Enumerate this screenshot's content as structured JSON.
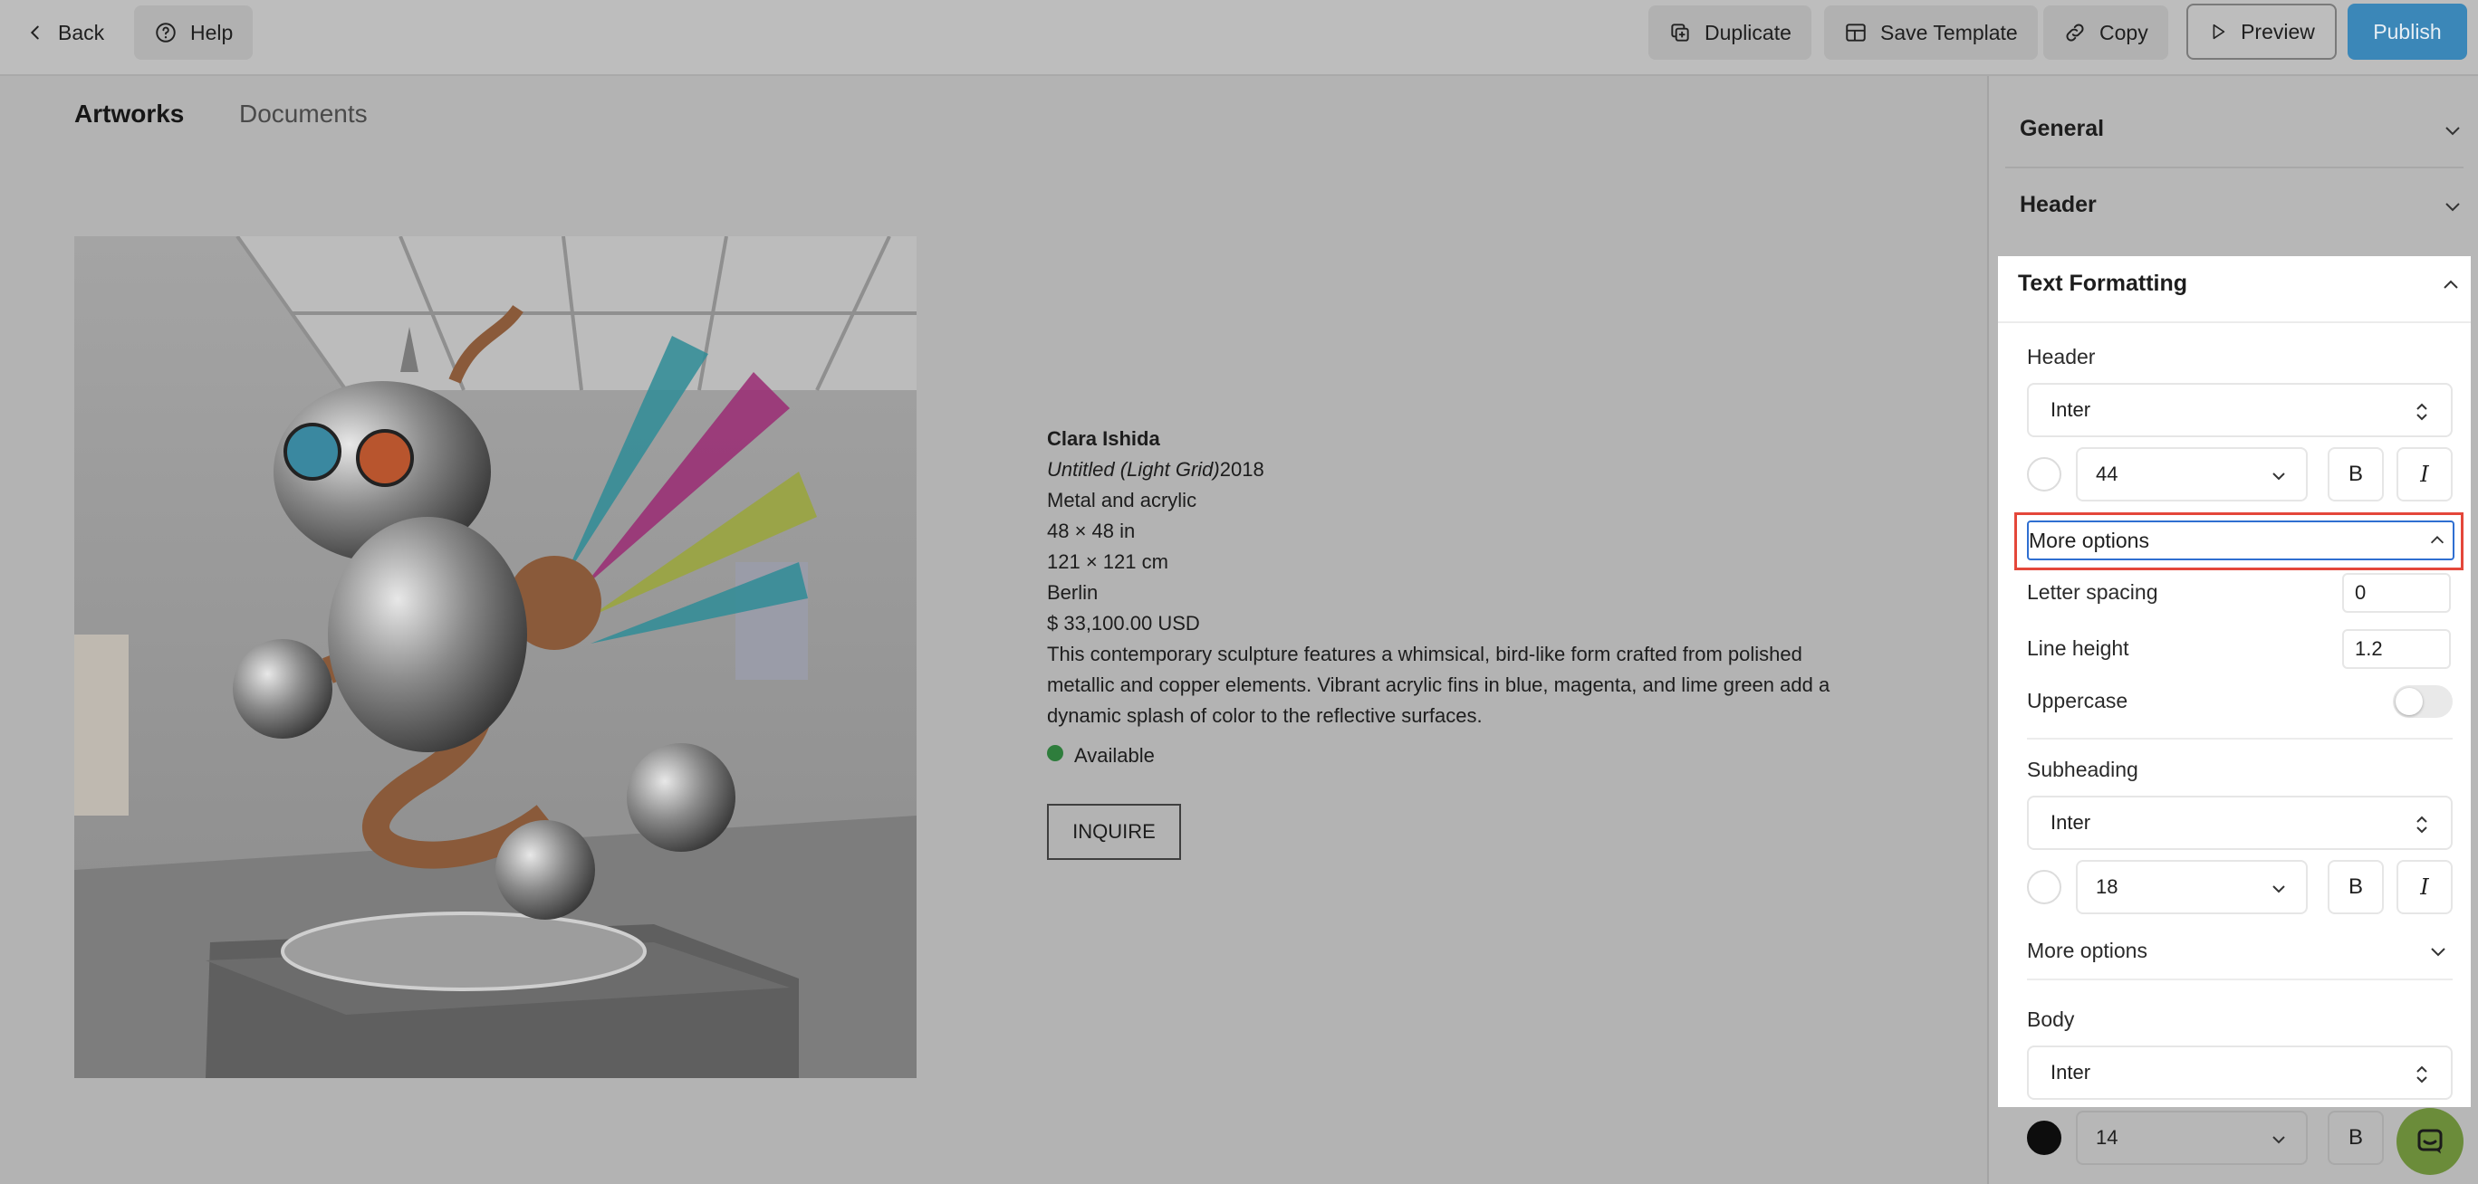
{
  "topbar": {
    "back_label": "Back",
    "help_label": "Help",
    "duplicate_label": "Duplicate",
    "save_template_label": "Save Template",
    "copy_label": "Copy",
    "preview_label": "Preview",
    "publish_label": "Publish"
  },
  "tabs": [
    {
      "label": "Artworks",
      "active": true
    },
    {
      "label": "Documents",
      "active": false
    }
  ],
  "artwork": {
    "artist": "Clara Ishida",
    "title": "Untitled (Light Grid)",
    "year": "2018",
    "medium": "Metal and acrylic",
    "size_in": "48 × 48 in",
    "size_cm": "121 × 121 cm",
    "location": "Berlin",
    "price": "$ 33,100.00 USD",
    "description_line1": "This contemporary sculpture features a whimsical, bird-like form crafted from polished",
    "description_line2": "metallic and copper elements. Vibrant acrylic fins in blue, magenta, and lime green add a",
    "description_line3": "dynamic splash of color to the reflective surfaces.",
    "availability": "Available",
    "availability_color": "#2e7d3c",
    "inquire_label": "INQUIRE"
  },
  "panel": {
    "general_label": "General",
    "header_label": "Header",
    "text_formatting_label": "Text Formatting",
    "header_section": {
      "label": "Header",
      "font": "Inter",
      "size": "44",
      "color": "#ffffff",
      "bold_label": "B",
      "italic_label": "I",
      "more_options_label": "More options",
      "more_options_expanded": true,
      "letter_spacing_label": "Letter spacing",
      "letter_spacing_value": "0",
      "line_height_label": "Line height",
      "line_height_value": "1.2",
      "uppercase_label": "Uppercase",
      "uppercase_on": false
    },
    "subheading_section": {
      "label": "Subheading",
      "font": "Inter",
      "size": "18",
      "color": "#ffffff",
      "bold_label": "B",
      "italic_label": "I",
      "more_options_label": "More options"
    },
    "body_section": {
      "label": "Body",
      "font": "Inter",
      "size": "14",
      "color": "#000000",
      "bold_label": "B"
    }
  },
  "colors": {
    "publish": "#3b87b8",
    "highlight": "#e4473a",
    "focus": "#2f6fd1",
    "chat": "#6b8c3a"
  }
}
